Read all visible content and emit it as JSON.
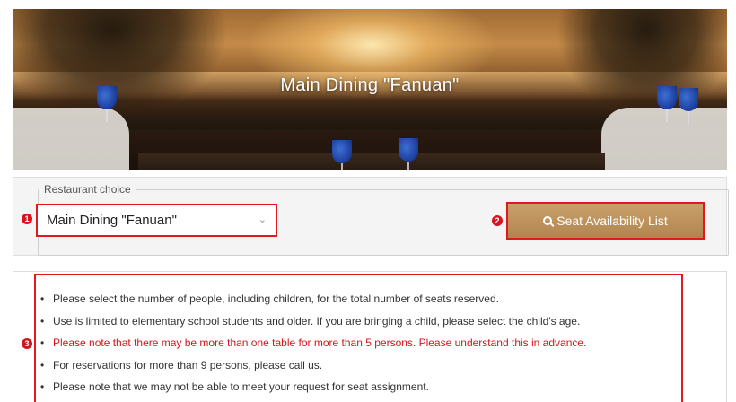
{
  "hero": {
    "title": "Main Dining \"Fanuan\""
  },
  "choice": {
    "legend": "Restaurant choice",
    "selected": "Main Dining \"Fanuan\"",
    "button_label": "Seat Availability List"
  },
  "badges": [
    "1",
    "2",
    "3"
  ],
  "notes": [
    {
      "text": "Please select the number of people, including children, for the total number of seats reserved.",
      "highlight": false
    },
    {
      "text": "Use is limited to elementary school students and older. If you are bringing a child, please select the child's age.",
      "highlight": false
    },
    {
      "text": "Please note that there may be more than one table for more than 5 persons. Please understand this in advance.",
      "highlight": true
    },
    {
      "text": "For reservations for more than 9 persons, please call us.",
      "highlight": false
    },
    {
      "text": "Please note that we may not be able to meet your request for seat assignment.",
      "highlight": false
    }
  ],
  "colors": {
    "annotation_red": "#e0181f",
    "button_gold": "#b98c56",
    "warning_text": "#d6141c"
  },
  "icons": [
    "search-icon",
    "chevron-down-icon"
  ]
}
